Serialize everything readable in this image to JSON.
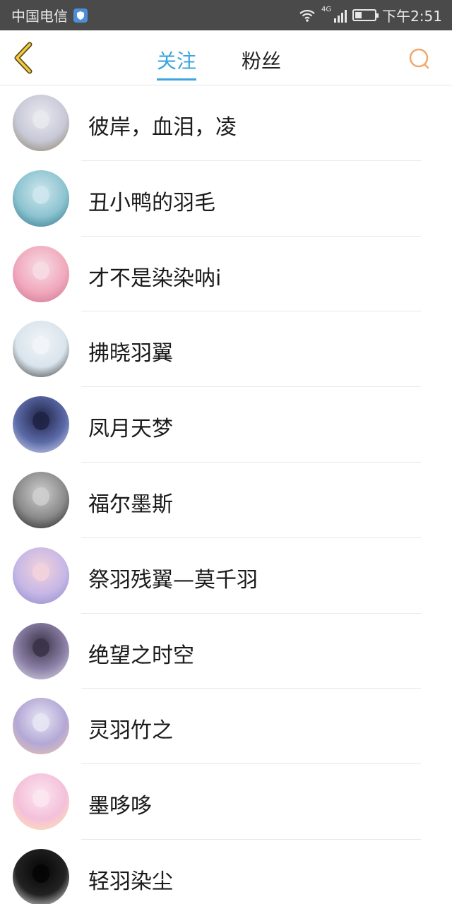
{
  "status_bar": {
    "carrier": "中国电信",
    "network": "4G",
    "time": "下午2:51",
    "battery_level": 0.35
  },
  "header": {
    "tabs": [
      {
        "label": "关注",
        "active": true
      },
      {
        "label": "粉丝",
        "active": false
      }
    ],
    "accent_color": "#3aa6dd",
    "back_icon": "chevron-left-icon",
    "search_icon": "search-icon"
  },
  "list": {
    "items": [
      {
        "name": "彼岸，血泪，凌",
        "avatar_colors": [
          "#e9e9ef",
          "#c8c9d8",
          "#8a7a5a"
        ]
      },
      {
        "name": "丑小鸭的羽毛",
        "avatar_colors": [
          "#cfe6ee",
          "#8cc4d0",
          "#2d6e86"
        ]
      },
      {
        "name": "才不是染染呐i",
        "avatar_colors": [
          "#f6dce4",
          "#f1a9bd",
          "#c76f8c"
        ]
      },
      {
        "name": "拂晓羽翼",
        "avatar_colors": [
          "#f2f5f8",
          "#d9e4ec",
          "#2b2b2b"
        ]
      },
      {
        "name": "凤月天梦",
        "avatar_colors": [
          "#1e2244",
          "#5b6aa8",
          "#dde3f5"
        ]
      },
      {
        "name": "福尔墨斯",
        "avatar_colors": [
          "#cfcfcf",
          "#8a8a8a",
          "#1c1c1c"
        ]
      },
      {
        "name": "祭羽残翼—莫千羽",
        "avatar_colors": [
          "#f2d2dc",
          "#c6b7e6",
          "#8a88c9"
        ]
      },
      {
        "name": "绝望之时空",
        "avatar_colors": [
          "#3a3346",
          "#8b7fa6",
          "#e6e2ee"
        ]
      },
      {
        "name": "灵羽竹之",
        "avatar_colors": [
          "#e8e6f4",
          "#b3a8d6",
          "#f0c4a8"
        ]
      },
      {
        "name": "墨哆哆",
        "avatar_colors": [
          "#fbe6f0",
          "#f4c0da",
          "#ffe8a8"
        ]
      },
      {
        "name": "轻羽染尘",
        "avatar_colors": [
          "#050505",
          "#222222",
          "#ffffff"
        ]
      }
    ]
  }
}
